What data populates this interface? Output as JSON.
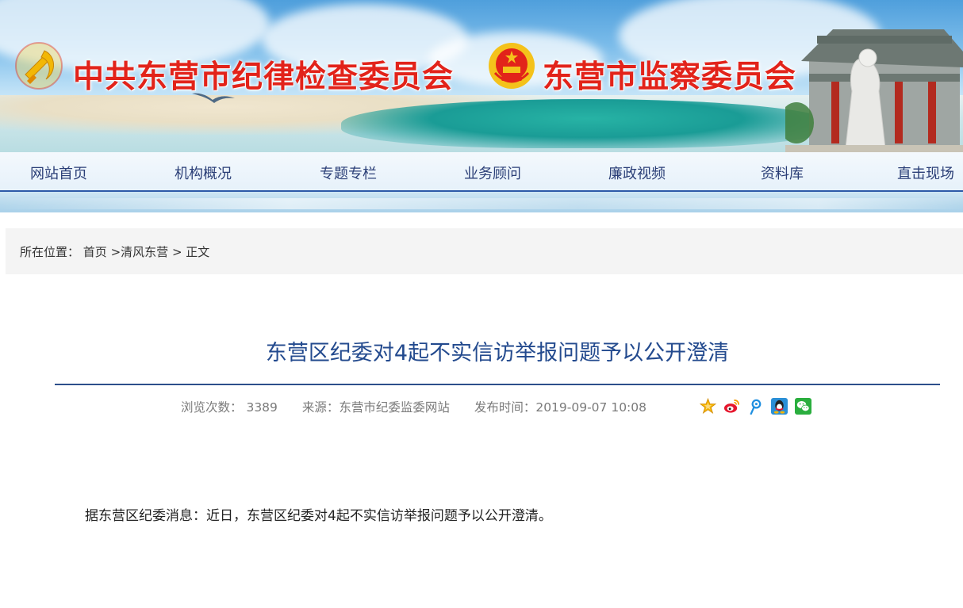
{
  "header": {
    "title_left": "中共东营市纪律检查委员会",
    "title_right": "东营市监察委员会",
    "title_color": "#e2231a",
    "emblems": [
      "party-emblem-icon",
      "national-emblem-icon"
    ]
  },
  "nav": {
    "items": [
      {
        "label": "网站首页"
      },
      {
        "label": "机构概况"
      },
      {
        "label": "专题专栏"
      },
      {
        "label": "业务顾问"
      },
      {
        "label": "廉政视频"
      },
      {
        "label": "资料库"
      },
      {
        "label": "直击现场"
      }
    ],
    "text_color": "#2b3f77",
    "underline_color": "#2d5aa8"
  },
  "breadcrumb": {
    "prefix": "所在位置：",
    "home": "首页",
    "sep1": " >",
    "section": "清风东营",
    "sep2": " > ",
    "current": "正文"
  },
  "article": {
    "title": "东营区纪委对4起不实信访举报问题予以公开澄清",
    "meta": {
      "views_label": "浏览次数：",
      "views": "3389",
      "source_label": "来源：",
      "source": "东营市纪委监委网站",
      "published_label": "发布时间：",
      "published": "2019-09-07 10:08"
    },
    "share_icons": [
      "favorite-star-icon",
      "weibo-icon",
      "tencent-weibo-icon",
      "qq-icon",
      "wechat-icon"
    ],
    "body": "据东营区纪委消息：近日，东营区纪委对4起不实信访举报问题予以公开澄清。",
    "title_color": "#234a8e"
  }
}
